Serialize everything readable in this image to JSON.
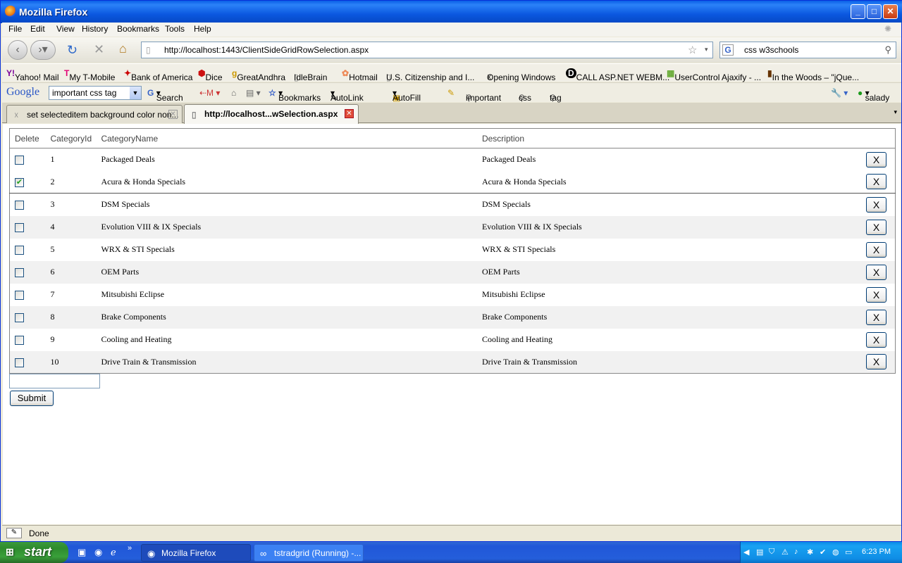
{
  "window": {
    "title": "Mozilla Firefox"
  },
  "menu": [
    "File",
    "Edit",
    "View",
    "History",
    "Bookmarks",
    "Tools",
    "Help"
  ],
  "nav": {
    "url": "http://localhost:1443/ClientSideGridRowSelection.aspx",
    "search": "css w3schools"
  },
  "bookmarks": [
    "Yahoo! Mail",
    "My T-Mobile",
    "Bank of America",
    "Dice",
    "GreatAndhra",
    "IdleBrain",
    "Hotmail",
    "U.S. Citizenship and I...",
    "Opening Windows",
    "CALL ASP.NET WEBM...",
    "UserControl Ajaxify - ...",
    "In the Woods – \"jQue..."
  ],
  "google_bar": {
    "logo": "Google",
    "query": "important css tag",
    "search_label": "Search",
    "bookmarks_label": "Bookmarks",
    "autolink_label": "AutoLink",
    "autofill_label": "AutoFill",
    "terms": [
      "important",
      "css",
      "tag"
    ],
    "user": "salady"
  },
  "tabs": [
    {
      "label": "set selecteditem background color non..."
    },
    {
      "label": "http://localhost...wSelection.aspx"
    }
  ],
  "grid": {
    "headers": [
      "Delete",
      "CategoryId",
      "CategoryName",
      "Description"
    ],
    "delete_button": "X",
    "rows": [
      {
        "id": "1",
        "name": "Packaged Deals",
        "desc": "Packaged Deals",
        "checked": false
      },
      {
        "id": "2",
        "name": "Acura & Honda Specials",
        "desc": "Acura & Honda Specials",
        "checked": true
      },
      {
        "id": "3",
        "name": "DSM Specials",
        "desc": "DSM Specials",
        "checked": false
      },
      {
        "id": "4",
        "name": "Evolution VIII & IX Specials",
        "desc": "Evolution VIII & IX Specials",
        "checked": false
      },
      {
        "id": "5",
        "name": "WRX & STI Specials",
        "desc": "WRX & STI Specials",
        "checked": false
      },
      {
        "id": "6",
        "name": "OEM Parts",
        "desc": "OEM Parts",
        "checked": false
      },
      {
        "id": "7",
        "name": "Mitsubishi Eclipse",
        "desc": "Mitsubishi Eclipse",
        "checked": false
      },
      {
        "id": "8",
        "name": "Brake Components",
        "desc": "Brake Components",
        "checked": false
      },
      {
        "id": "9",
        "name": "Cooling and Heating",
        "desc": "Cooling and Heating",
        "checked": false
      },
      {
        "id": "10",
        "name": "Drive Train & Transmission",
        "desc": "Drive Train & Transmission",
        "checked": false
      }
    ]
  },
  "form": {
    "textbox_value": "",
    "submit_label": "Submit"
  },
  "status": {
    "text": "Done"
  },
  "taskbar": {
    "start_label": "start",
    "tasks": [
      "Mozilla Firefox",
      "tstradgrid (Running) -..."
    ],
    "clock": "6:23 PM"
  },
  "colors": {
    "titlebar": "#0b58e0",
    "taskbar": "#245edb",
    "start": "#39a03a",
    "alt_row": "#f1f1f1"
  }
}
